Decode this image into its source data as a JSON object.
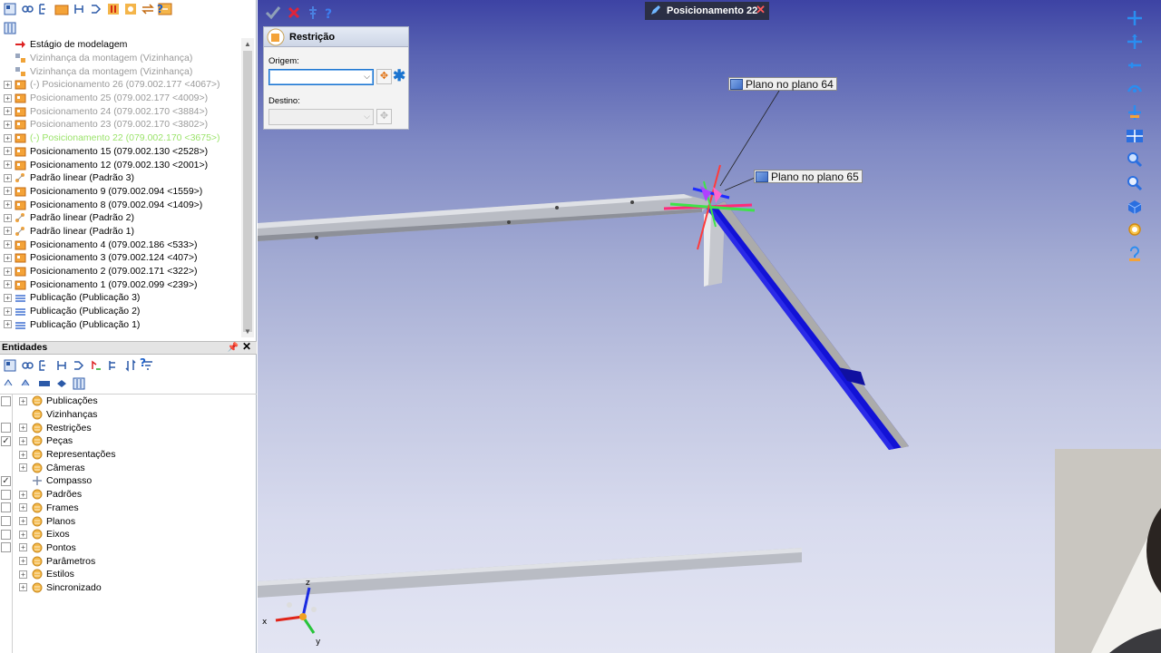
{
  "tree": {
    "items": [
      {
        "label": "Estágio de modelagem",
        "style": "normal",
        "expand": false,
        "icon": "arrow-red-icon"
      },
      {
        "label": "Vizinhança da montagem (Vizinhança)",
        "style": "grey",
        "expand": false,
        "icon": "neighborhood-icon"
      },
      {
        "label": "Vizinhança da montagem (Vizinhança)",
        "style": "grey",
        "expand": false,
        "icon": "neighborhood-icon"
      },
      {
        "label": "(-) Posicionamento 26 (079.002.177 <4067>)",
        "style": "grey",
        "expand": true,
        "icon": "placement-icon"
      },
      {
        "label": "Posicionamento 25 (079.002.177 <4009>)",
        "style": "grey",
        "expand": true,
        "icon": "placement-icon"
      },
      {
        "label": "Posicionamento 24 (079.002.170 <3884>)",
        "style": "grey",
        "expand": true,
        "icon": "placement-icon"
      },
      {
        "label": "Posicionamento 23 (079.002.170 <3802>)",
        "style": "grey",
        "expand": true,
        "icon": "placement-icon"
      },
      {
        "label": "(-) Posicionamento 22 (079.002.170 <3675>)",
        "style": "green",
        "expand": true,
        "icon": "placement-icon"
      },
      {
        "label": "Posicionamento 15 (079.002.130 <2528>)",
        "style": "normal",
        "expand": true,
        "icon": "placement-icon"
      },
      {
        "label": "Posicionamento 12 (079.002.130 <2001>)",
        "style": "normal",
        "expand": true,
        "icon": "placement-icon"
      },
      {
        "label": "Padrão linear (Padrão 3)",
        "style": "normal",
        "expand": true,
        "icon": "linear-pattern-icon"
      },
      {
        "label": "Posicionamento 9 (079.002.094 <1559>)",
        "style": "normal",
        "expand": true,
        "icon": "placement-icon"
      },
      {
        "label": "Posicionamento 8 (079.002.094 <1409>)",
        "style": "normal",
        "expand": true,
        "icon": "placement-icon"
      },
      {
        "label": "Padrão linear (Padrão 2)",
        "style": "normal",
        "expand": true,
        "icon": "linear-pattern-icon"
      },
      {
        "label": "Padrão linear (Padrão 1)",
        "style": "normal",
        "expand": true,
        "icon": "linear-pattern-icon"
      },
      {
        "label": "Posicionamento 4 (079.002.186 <533>)",
        "style": "normal",
        "expand": true,
        "icon": "placement-icon"
      },
      {
        "label": "Posicionamento 3 (079.002.124 <407>)",
        "style": "normal",
        "expand": true,
        "icon": "placement-icon"
      },
      {
        "label": "Posicionamento 2 (079.002.171 <322>)",
        "style": "normal",
        "expand": true,
        "icon": "placement-icon"
      },
      {
        "label": "Posicionamento 1 (079.002.099 <239>)",
        "style": "normal",
        "expand": true,
        "icon": "placement-icon"
      },
      {
        "label": "Publicação (Publicação 3)",
        "style": "normal",
        "expand": true,
        "icon": "publication-icon"
      },
      {
        "label": "Publicação (Publicação 2)",
        "style": "normal",
        "expand": true,
        "icon": "publication-icon"
      },
      {
        "label": "Publicação (Publicação 1)",
        "style": "normal",
        "expand": true,
        "icon": "publication-icon"
      }
    ]
  },
  "entities": {
    "title": "Entidades",
    "items": [
      {
        "label": "Publicações",
        "checkbox": true,
        "checked": false,
        "expand": true
      },
      {
        "label": "Vizinhanças",
        "checkbox": false,
        "checked": false,
        "expand": false
      },
      {
        "label": "Restrições",
        "checkbox": true,
        "checked": false,
        "expand": true
      },
      {
        "label": "Peças",
        "checkbox": true,
        "checked": true,
        "expand": true
      },
      {
        "label": "Representações",
        "checkbox": false,
        "checked": false,
        "expand": true
      },
      {
        "label": "Câmeras",
        "checkbox": false,
        "checked": false,
        "expand": true
      },
      {
        "label": "Compasso",
        "checkbox": true,
        "checked": true,
        "expand": false
      },
      {
        "label": "Padrões",
        "checkbox": true,
        "checked": false,
        "expand": true
      },
      {
        "label": "Frames",
        "checkbox": true,
        "checked": false,
        "expand": true
      },
      {
        "label": "Planos",
        "checkbox": true,
        "checked": false,
        "expand": true
      },
      {
        "label": "Eixos",
        "checkbox": true,
        "checked": false,
        "expand": true
      },
      {
        "label": "Pontos",
        "checkbox": true,
        "checked": false,
        "expand": true
      },
      {
        "label": "Parâmetros",
        "checkbox": false,
        "checked": false,
        "expand": true
      },
      {
        "label": "Estilos",
        "checkbox": false,
        "checked": false,
        "expand": true
      },
      {
        "label": "Sincronizado",
        "checkbox": false,
        "checked": false,
        "expand": true
      }
    ]
  },
  "viewport": {
    "tab_title": "Posicionamento 22",
    "restriction_panel": {
      "title": "Restrição",
      "origin_label": "Origem:",
      "destination_label": "Destino:"
    },
    "plane_labels": [
      "Plano no plano 64",
      "Plano no plano 65"
    ],
    "axis_labels": {
      "x": "x",
      "y": "y",
      "z": "z"
    }
  },
  "colors": {
    "selected_beam": "#1010d8",
    "accent": "#1a74d0",
    "close_red": "#ff5a5a"
  }
}
